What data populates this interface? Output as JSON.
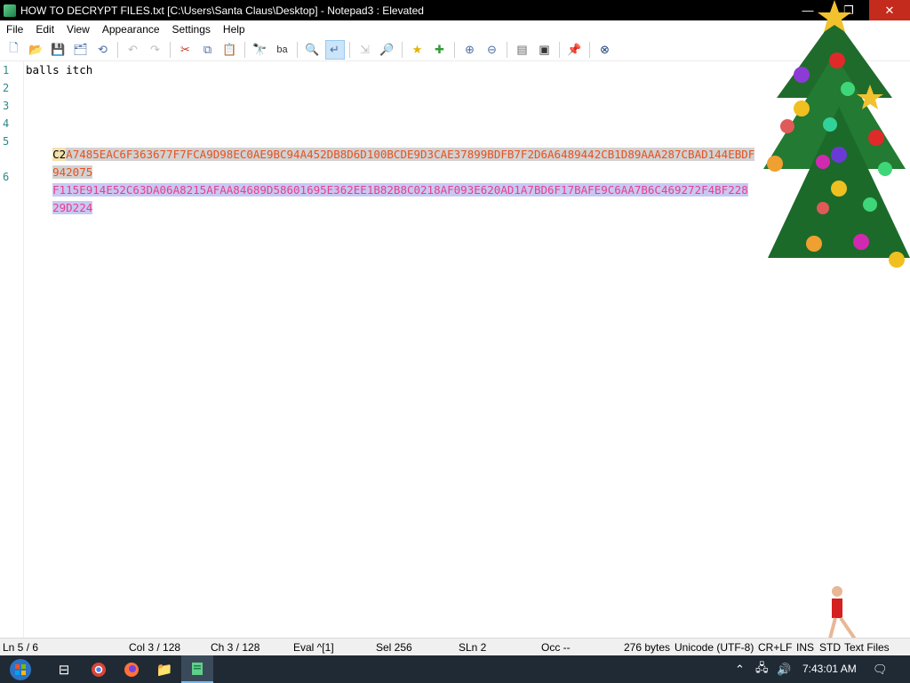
{
  "window": {
    "title": "HOW TO DECRYPT FILES.txt [C:\\Users\\Santa Claus\\Desktop] - Notepad3 : Elevated",
    "minimize": "—",
    "maximize": "❐",
    "close": "✕"
  },
  "menu": [
    "File",
    "Edit",
    "View",
    "Appearance",
    "Settings",
    "Help"
  ],
  "toolbar": [
    {
      "name": "new-file-icon",
      "glyph": "🗋"
    },
    {
      "name": "open-folder-icon",
      "glyph": "📂"
    },
    {
      "name": "save-icon",
      "glyph": "💾"
    },
    {
      "name": "save-as-icon",
      "glyph": "🗂"
    },
    {
      "name": "browse-icon",
      "glyph": "⟲"
    },
    {
      "name": "undo-icon",
      "glyph": "↶"
    },
    {
      "name": "redo-icon",
      "glyph": "↷"
    },
    {
      "name": "cut-icon",
      "glyph": "✂"
    },
    {
      "name": "copy-icon",
      "glyph": "⧉"
    },
    {
      "name": "paste-icon",
      "glyph": "📋"
    },
    {
      "name": "find-icon",
      "glyph": "🔭"
    },
    {
      "name": "replace-icon",
      "glyph": "ba"
    },
    {
      "name": "find-in-files-icon",
      "glyph": "🔍"
    },
    {
      "name": "word-wrap-icon",
      "glyph": "↵"
    },
    {
      "name": "toggle-view-icon",
      "glyph": "⇲"
    },
    {
      "name": "search-icon",
      "glyph": "🔎"
    },
    {
      "name": "favorites-icon",
      "glyph": "★"
    },
    {
      "name": "add-favorite-icon",
      "glyph": "✚"
    },
    {
      "name": "zoom-in-icon",
      "glyph": "⊕"
    },
    {
      "name": "zoom-out-icon",
      "glyph": "⊖"
    },
    {
      "name": "schemes-icon",
      "glyph": "▤"
    },
    {
      "name": "screen-icon",
      "glyph": "▣"
    },
    {
      "name": "pin-icon",
      "glyph": "📌"
    },
    {
      "name": "exit-icon",
      "glyph": "⊗"
    }
  ],
  "editor": {
    "line_numbers": [
      "1",
      "2",
      "3",
      "4",
      "5",
      "6"
    ],
    "line1": "balls itch",
    "line5_lead": "C2",
    "line5_rest": "A7485EAC6F363677F7FCA9D98EC0AE9BC94A452DB8D6D100BCDE9D3CAE37899BDFB7F2D6A6489442CB1D89AAA287CBAD144EBDF",
    "line5_wrap": "942075",
    "line6": "F115E914E52C63DA06A8215AFAA84689D58601695E362EE1B82B8C0218AF093E620AD1A7BD6F17BAFE9C6AA7B6C469272F4BF228",
    "line6_wrap": "29D224"
  },
  "status": {
    "ln": "Ln  5 / 6",
    "col": "Col  3 / 128",
    "ch": "Ch  3 / 128",
    "eval": "Eval  ^[1]",
    "sel": "Sel  256",
    "sln": "SLn  2",
    "occ": "Occ  --",
    "bytes": "276 bytes",
    "encoding": "Unicode (UTF-8)",
    "eol": "CR+LF",
    "ins": "INS",
    "ovr": "STD",
    "lexer": "Text Files"
  },
  "taskbar": {
    "clock": "7:43:01 AM"
  }
}
